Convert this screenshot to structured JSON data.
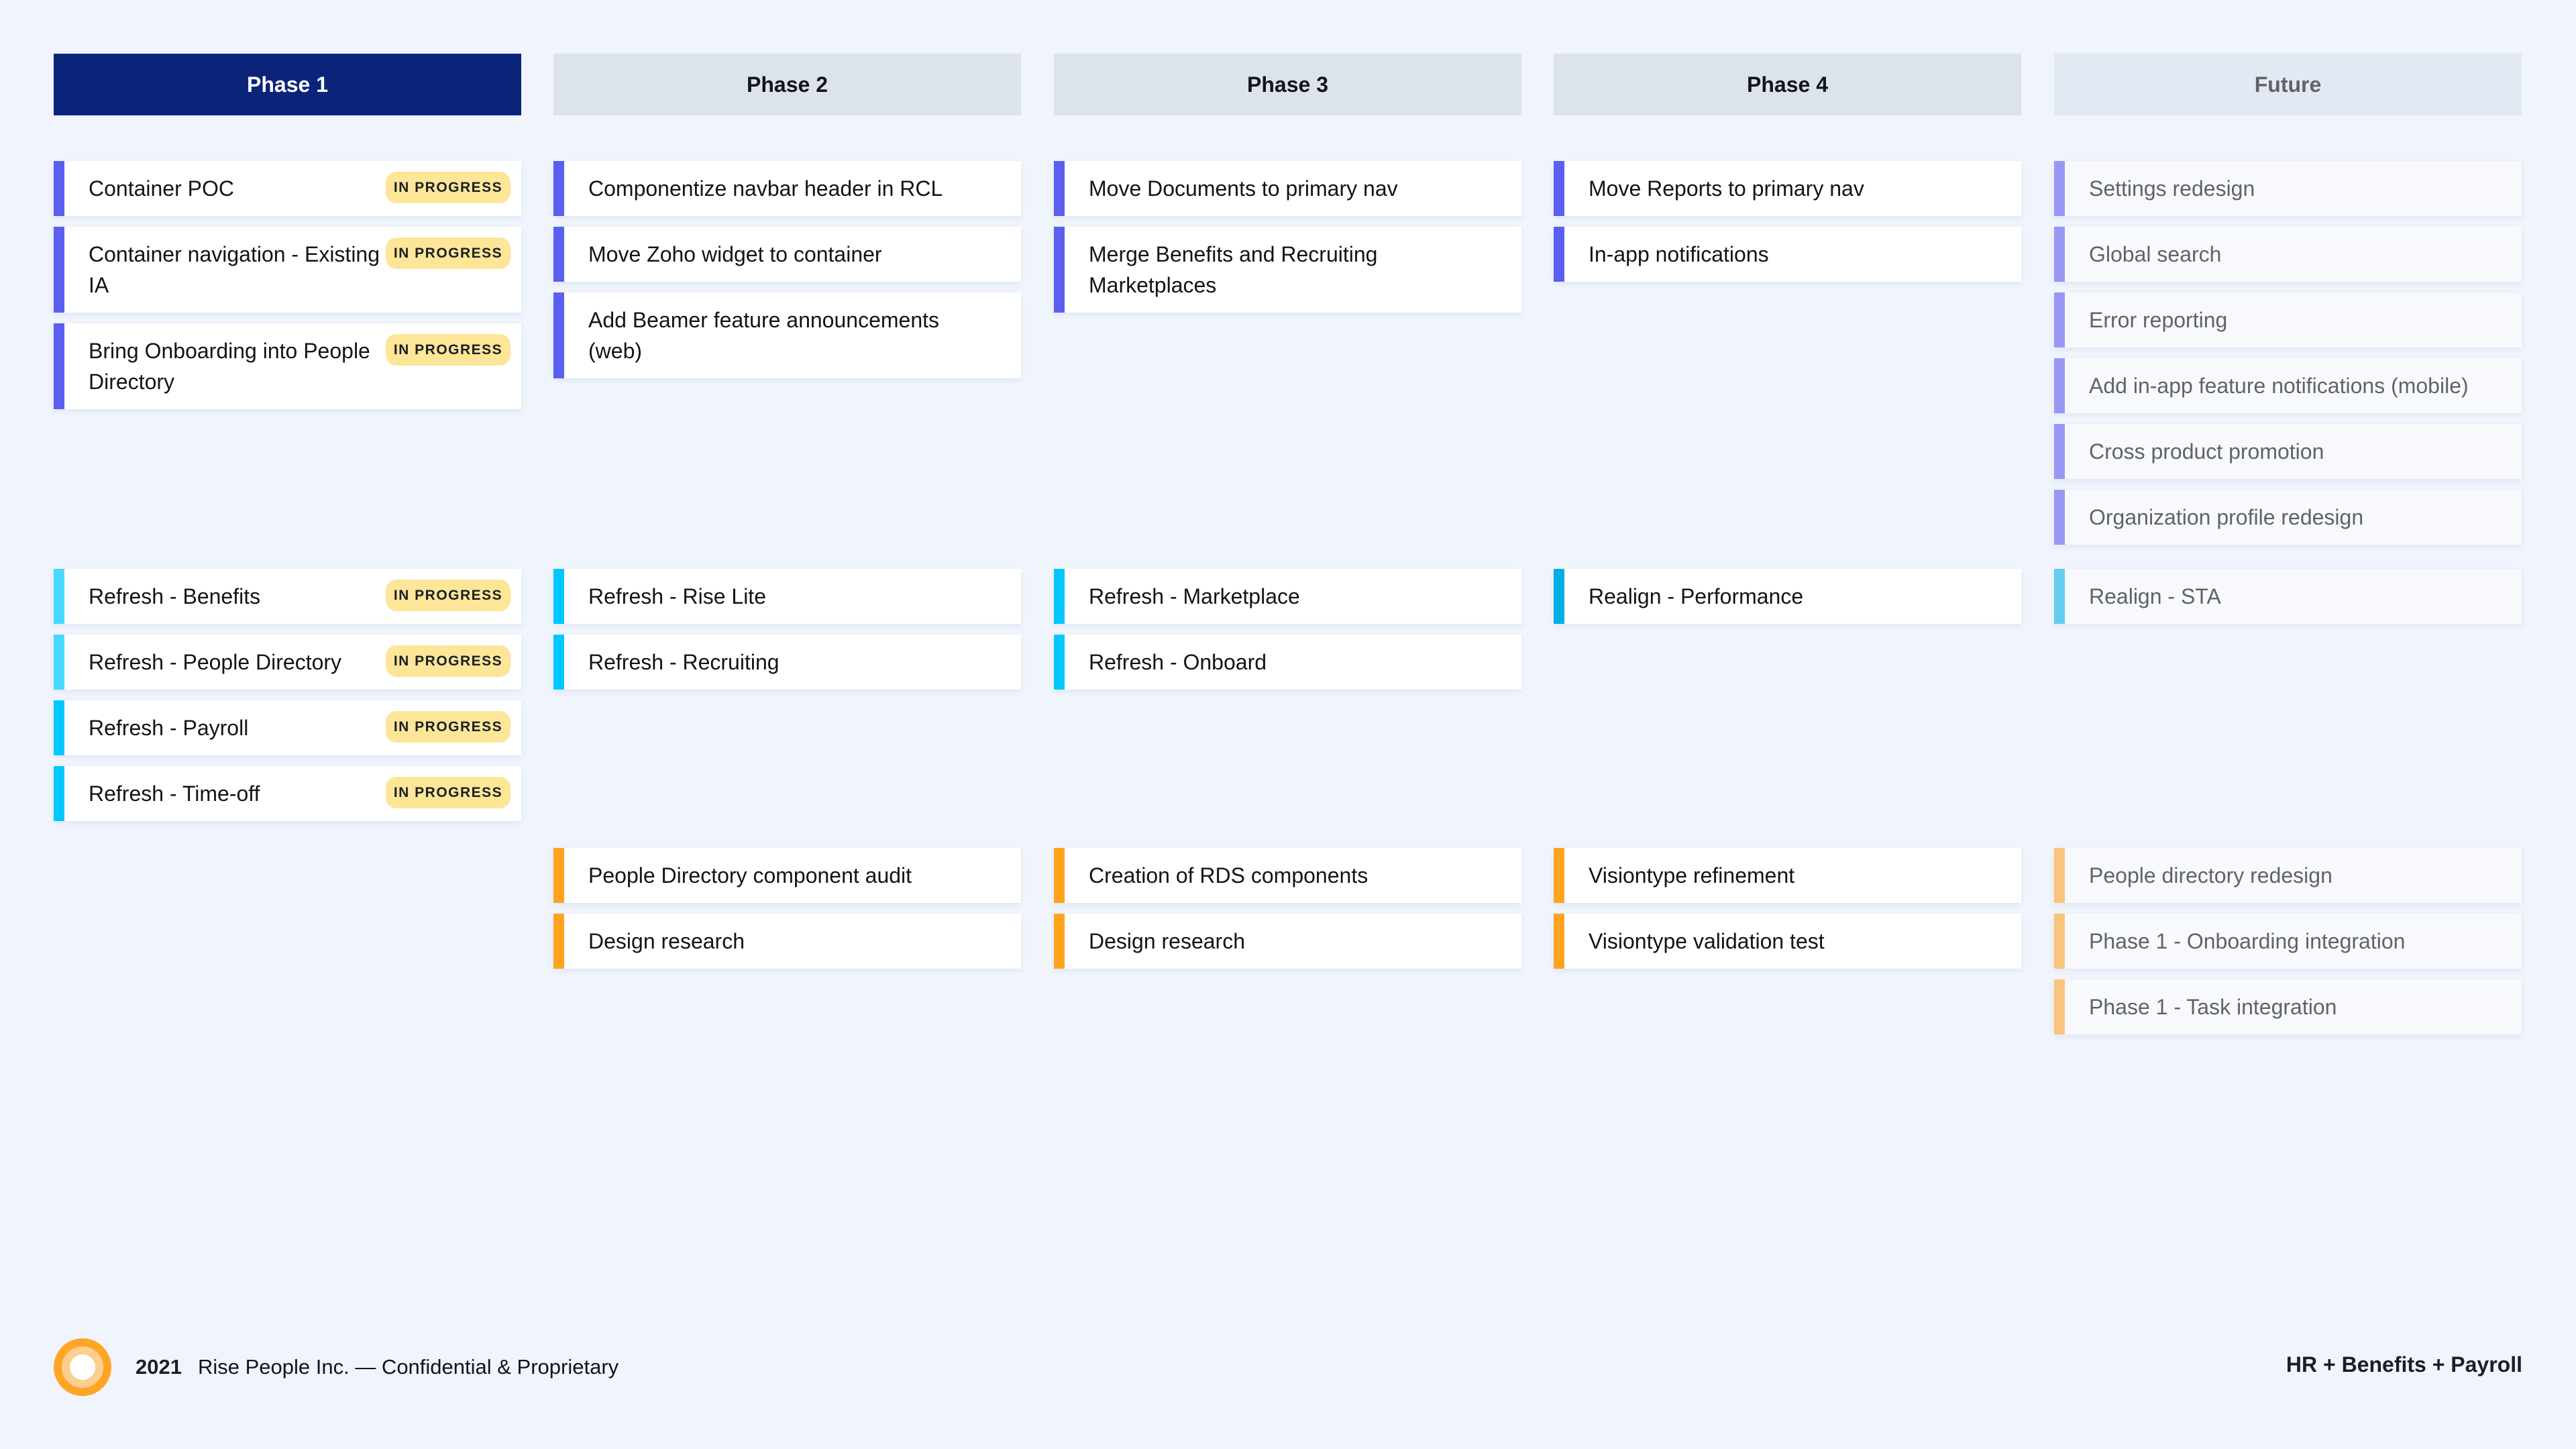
{
  "colors": {
    "phase_accent": "#5a5ff0",
    "future_accent": "#9898f4",
    "refresh_light": "#48d8ff",
    "refresh": "#00c8ff",
    "realign": "#00aee6",
    "realign_future": "#64cdef",
    "research": "#ffa31f",
    "research_future": "#f9c57c",
    "badge_bg": "#fde698",
    "active_header": "#0b247a"
  },
  "columns": [
    {
      "header": "Phase 1",
      "groups": [
        [
          {
            "title": "Container POC",
            "badge": "IN PROGRESS",
            "accent": "#5a5ff0"
          },
          {
            "title": "Container navigation - Existing IA",
            "badge": "IN PROGRESS",
            "accent": "#5a5ff0"
          },
          {
            "title": "Bring Onboarding into People Directory",
            "badge": "IN PROGRESS",
            "accent": "#5a5ff0"
          }
        ],
        [
          {
            "title": "Refresh - Benefits",
            "badge": "IN PROGRESS",
            "accent": "#48d8ff"
          },
          {
            "title": "Refresh -  People Directory",
            "badge": "IN PROGRESS",
            "accent": "#48d8ff"
          },
          {
            "title": "Refresh - Payroll",
            "badge": "IN PROGRESS",
            "accent": "#00c8ff"
          },
          {
            "title": "Refresh - Time-off",
            "badge": "IN PROGRESS",
            "accent": "#00c8ff"
          }
        ],
        []
      ]
    },
    {
      "header": "Phase 2",
      "groups": [
        [
          {
            "title": "Componentize navbar header in RCL",
            "accent": "#5a5ff0"
          },
          {
            "title": "Move Zoho widget to container",
            "accent": "#5a5ff0"
          },
          {
            "title": "Add Beamer feature announcements (web)",
            "accent": "#5a5ff0"
          }
        ],
        [
          {
            "title": "Refresh - Rise Lite",
            "accent": "#00c8ff"
          },
          {
            "title": "Refresh - Recruiting",
            "accent": "#00c8ff"
          }
        ],
        [
          {
            "title": "People Directory component audit",
            "accent": "#ffa31f"
          },
          {
            "title": "Design research",
            "accent": "#ffa31f"
          }
        ]
      ]
    },
    {
      "header": "Phase 3",
      "groups": [
        [
          {
            "title": "Move Documents to primary nav",
            "accent": "#5a5ff0"
          },
          {
            "title": "Merge Benefits and Recruiting Marketplaces",
            "accent": "#5a5ff0"
          }
        ],
        [
          {
            "title": "Refresh - Marketplace",
            "accent": "#00c8ff"
          },
          {
            "title": "Refresh - Onboard",
            "accent": "#00c8ff"
          }
        ],
        [
          {
            "title": "Creation of RDS components",
            "accent": "#ffa31f"
          },
          {
            "title": "Design research",
            "accent": "#ffa31f"
          }
        ]
      ]
    },
    {
      "header": "Phase 4",
      "groups": [
        [
          {
            "title": "Move Reports to primary nav",
            "accent": "#5a5ff0"
          },
          {
            "title": "In-app notifications",
            "accent": "#5a5ff0"
          }
        ],
        [
          {
            "title": "Realign - Performance",
            "accent": "#00aee6"
          }
        ],
        [
          {
            "title": "Visiontype refinement",
            "accent": "#ffa31f"
          },
          {
            "title": "Visiontype validation test",
            "accent": "#ffa31f"
          }
        ]
      ]
    },
    {
      "header": "Future",
      "groups": [
        [
          {
            "title": "Settings redesign",
            "accent": "#9898f4"
          },
          {
            "title": "Global search",
            "accent": "#9898f4"
          },
          {
            "title": "Error reporting",
            "accent": "#9898f4"
          },
          {
            "title": "Add in-app feature notifications (mobile)",
            "accent": "#9898f4"
          },
          {
            "title": "Cross product promotion",
            "accent": "#9898f4"
          },
          {
            "title": "Organization profile redesign",
            "accent": "#9898f4"
          }
        ],
        [
          {
            "title": "Realign - STA",
            "accent": "#64cdef"
          }
        ],
        [
          {
            "title": "People directory redesign",
            "accent": "#f9c57c"
          },
          {
            "title": "Phase 1 - Onboarding integration",
            "accent": "#f9c57c"
          },
          {
            "title": "Phase 1 - Task integration",
            "accent": "#f9c57c"
          }
        ]
      ]
    }
  ],
  "footer": {
    "logo_icon": "rise-logo-concentric-circles",
    "year": "2021",
    "company": "Rise People Inc. — Confidential & Proprietary",
    "tagline": "HR + Benefits + Payroll"
  }
}
